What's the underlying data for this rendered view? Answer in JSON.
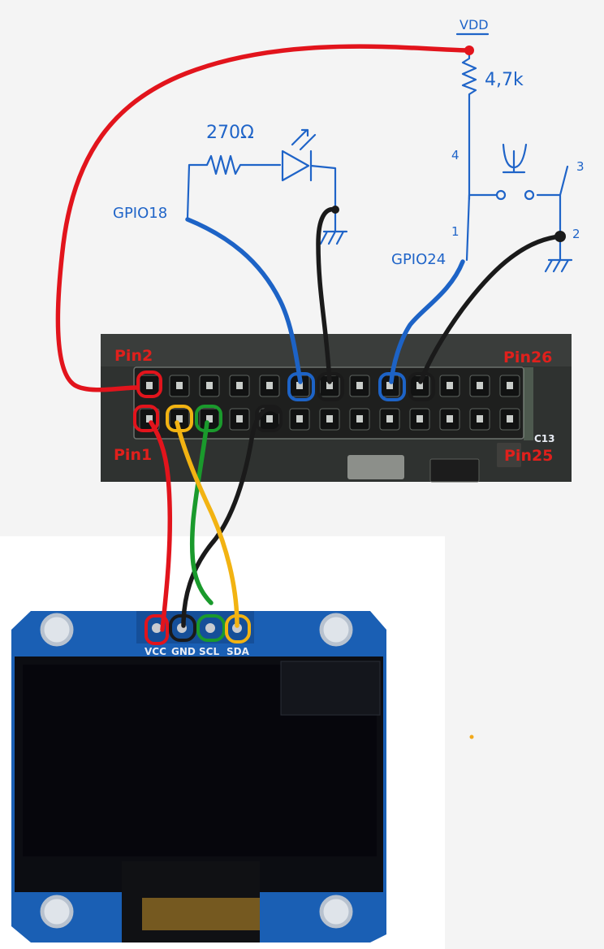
{
  "schematic": {
    "vdd_label": "VDD",
    "pullup_resistor": "4,7k",
    "led_resistor": "270Ω",
    "gpio18": "GPIO18",
    "gpio24": "GPIO24",
    "button_pins": {
      "p1": "1",
      "p2": "2",
      "p3": "3",
      "p4": "4"
    }
  },
  "header": {
    "pin2": "Pin2",
    "pin1": "Pin1",
    "pin26": "Pin26",
    "pin25": "Pin25",
    "board_marking": "C13"
  },
  "oled": {
    "pins": [
      "VCC",
      "GND",
      "SCL",
      "SDA"
    ]
  },
  "colors": {
    "vcc_wire": "#e2141c",
    "gnd_wire": "#1a1a1a",
    "scl_wire": "#1a9a2c",
    "sda_wire": "#f2b312",
    "gpio_wire": "#1d63c6",
    "ink": "#1f64c8",
    "pcb_blue": "#1a5fb4"
  }
}
